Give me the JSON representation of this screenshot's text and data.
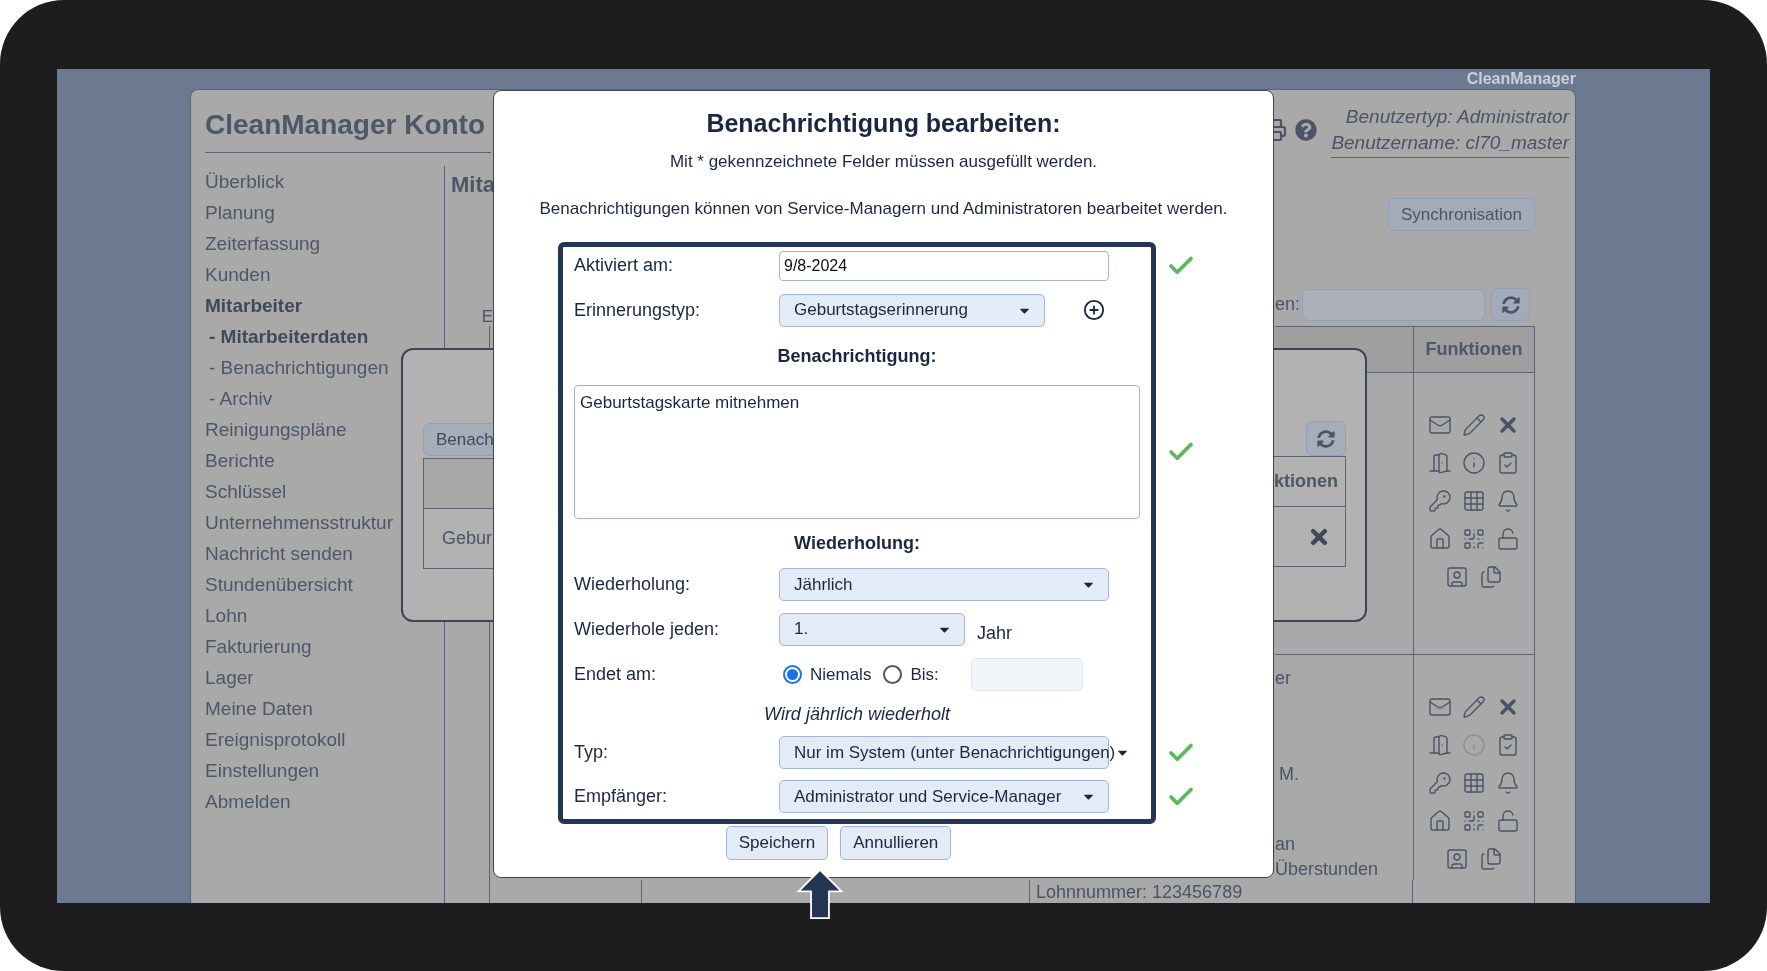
{
  "screen_label": "CleanManager",
  "app": {
    "title": "CleanManager Konto",
    "user_type": "Benutzertyp: Administrator",
    "user_name": "Benutzername: cl70_master"
  },
  "sidebar": {
    "items": [
      {
        "label": "Überblick",
        "selected": false
      },
      {
        "label": "Planung",
        "selected": false
      },
      {
        "label": "Zeiterfassung",
        "selected": false
      },
      {
        "label": "Kunden",
        "selected": false
      },
      {
        "label": "Mitarbeiter",
        "selected": true,
        "children": [
          {
            "label": "- Mitarbeiterdaten",
            "selected": true
          },
          {
            "label": "- Benachrichtigungen",
            "selected": false
          },
          {
            "label": "- Archiv",
            "selected": false
          }
        ]
      },
      {
        "label": "Reinigungspläne",
        "selected": false
      },
      {
        "label": "Berichte",
        "selected": false
      },
      {
        "label": "Schlüssel",
        "selected": false
      },
      {
        "label": "Unternehmensstruktur",
        "selected": false
      },
      {
        "label": "Nachricht senden",
        "selected": false
      },
      {
        "label": "Stundenübersicht",
        "selected": false
      },
      {
        "label": "Lohn",
        "selected": false
      },
      {
        "label": "Fakturierung",
        "selected": false
      },
      {
        "label": "Lager",
        "selected": false
      },
      {
        "label": "Meine Daten",
        "selected": false
      },
      {
        "label": "Ereignisprotokoll",
        "selected": false
      },
      {
        "label": "Einstellungen",
        "selected": false
      },
      {
        "label": "Abmelden",
        "selected": false
      }
    ]
  },
  "main": {
    "heading_fragment": "Mita",
    "label_fragment": "E",
    "sync_button": "Synchronisation",
    "search_label_fragment": "en:",
    "table": {
      "header": "Funktionen",
      "rows": [
        {
          "texts": [],
          "icons": [
            {
              "kind": "mail",
              "disabled": false
            },
            {
              "kind": "edit",
              "disabled": false
            },
            {
              "kind": "delete",
              "disabled": false
            },
            {
              "kind": "door",
              "disabled": false
            },
            {
              "kind": "info",
              "disabled": false
            },
            {
              "kind": "clipboard",
              "disabled": false
            },
            {
              "kind": "key",
              "disabled": false
            },
            {
              "kind": "grid",
              "disabled": false
            },
            {
              "kind": "bell",
              "disabled": false
            },
            {
              "kind": "house",
              "disabled": false
            },
            {
              "kind": "qr",
              "disabled": false
            },
            {
              "kind": "unlock",
              "disabled": false
            },
            {
              "kind": "portrait",
              "disabled": false
            },
            {
              "kind": "files",
              "disabled": false
            }
          ]
        },
        {
          "texts": [
            "er",
            "M.",
            "an",
            "Überstunden"
          ],
          "icons": [
            {
              "kind": "mail",
              "disabled": false
            },
            {
              "kind": "edit",
              "disabled": false
            },
            {
              "kind": "delete",
              "disabled": false
            },
            {
              "kind": "door",
              "disabled": false
            },
            {
              "kind": "info",
              "disabled": true
            },
            {
              "kind": "clipboard",
              "disabled": false
            },
            {
              "kind": "key",
              "disabled": false
            },
            {
              "kind": "grid",
              "disabled": false
            },
            {
              "kind": "bell",
              "disabled": false
            },
            {
              "kind": "house",
              "disabled": false
            },
            {
              "kind": "qr",
              "disabled": false
            },
            {
              "kind": "unlock",
              "disabled": false
            },
            {
              "kind": "portrait",
              "disabled": false
            },
            {
              "kind": "files",
              "disabled": false
            }
          ]
        }
      ],
      "footer_cell": "Lohnnummer: 123456789"
    }
  },
  "background_dialog": {
    "button_fragment": "Benach",
    "cell_fragment": "Gebur",
    "header_fragment": "ktionen"
  },
  "dialog": {
    "title": "Benachrichtigung bearbeiten:",
    "subtitle": "Mit * gekennzeichnete Felder müssen ausgefüllt werden.",
    "info": "Benachrichtigungen können von Service-Managern und Administratoren bearbeitet werden.",
    "fields": [
      {
        "kind": "text",
        "label": "Aktiviert am:",
        "value": "9/8-2024",
        "valid": true
      },
      {
        "kind": "select_add",
        "label": "Erinnerungstyp:",
        "value": "Geburtstagserinnerung"
      },
      {
        "kind": "heading",
        "text": "Benachrichtigung:"
      },
      {
        "kind": "textarea",
        "value": "Geburtstagskarte mitnehmen",
        "valid": true
      },
      {
        "kind": "heading",
        "text": "Wiederholung:"
      },
      {
        "kind": "select",
        "label": "Wiederholung:",
        "value": "Jährlich"
      },
      {
        "kind": "select_unit",
        "label": "Wiederhole jeden:",
        "value": "1.",
        "unit": "Jahr"
      },
      {
        "kind": "radio",
        "label": "Endet am:",
        "options": [
          {
            "label": "Niemals",
            "selected": true
          },
          {
            "label": "Bis:",
            "selected": false
          }
        ],
        "date_disabled": true
      },
      {
        "kind": "note",
        "text": "Wird jährlich wiederholt"
      },
      {
        "kind": "select",
        "label": "Typ:",
        "value": "Nur im System (unter Benachrichtigungen)",
        "valid": true
      },
      {
        "kind": "select",
        "label": "Empfänger:",
        "value": "Administrator und Service-Manager",
        "valid": true
      }
    ],
    "buttons": [
      {
        "label": "Speichern"
      },
      {
        "label": "Annullieren"
      }
    ]
  }
}
